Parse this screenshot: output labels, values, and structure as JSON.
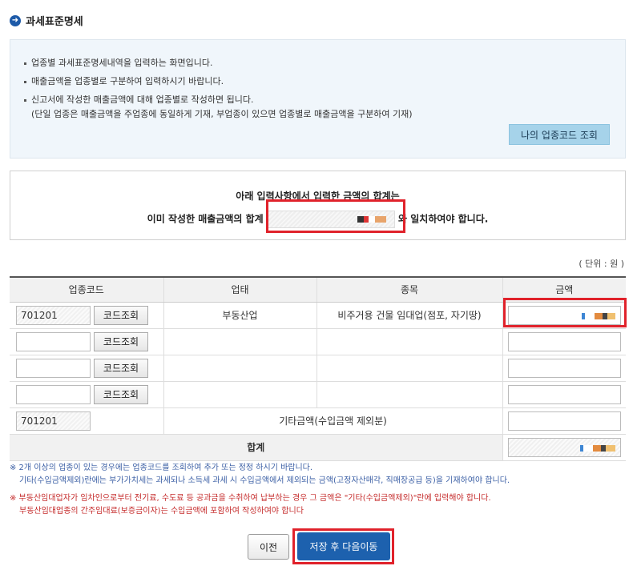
{
  "page": {
    "title": "과세표준명세"
  },
  "info": {
    "lines": [
      "업종별 과세표준명세내역을 입력하는 화면입니다.",
      "매출금액을 업종별로 구분하여 입력하시기 바랍니다.",
      "신고서에 작성한 매출금액에 대해 업종별로 작성하면 됩니다."
    ],
    "sub_line": "(단일 업종은 매출금액을 주업종에 동일하게 기재, 부업종이 있으면 업종별로 매출금액을 구분하여 기재)",
    "my_code_button": "나의 업종코드 조회"
  },
  "notice": {
    "line1": "아래 입력사항에서  입력한 금액의 합계는",
    "line2_before": "이미 작성한 매출금액의 합계",
    "line2_after": "와 일치하여야 합니다."
  },
  "unit_label": "( 단위 : 원 )",
  "table": {
    "headers": [
      "업종코드",
      "업태",
      "종목",
      "금액"
    ],
    "lookup_label": "코드조회",
    "rows": [
      {
        "code": "701201",
        "business_type": "부동산업",
        "item": "비주거용 건물 임대업(점포, 자기땅)"
      },
      {
        "code": "",
        "business_type": "",
        "item": ""
      },
      {
        "code": "",
        "business_type": "",
        "item": ""
      },
      {
        "code": "",
        "business_type": "",
        "item": ""
      }
    ],
    "other_row": {
      "code": "701201",
      "label": "기타금액(수입금액 제외분)"
    },
    "total_label": "합계"
  },
  "notes_blue": [
    "※ 2개 이상의 업종이 있는 경우에는 업종코드를 조회하여 추가 또는 정정 하시기 바랍니다.",
    "기타(수입금액제외)란에는 부가가치세는 과세되나 소득세 과세 시 수입금액에서 제외되는 금액(고정자산매각, 직매장공급 등)을 기재하여야 합니다."
  ],
  "notes_red": [
    "※ 부동산임대업자가 임차인으로부터 전기료, 수도료 등 공과금을 수취하여 납부하는 경우 그 금액은 \"기타(수입금액제외)\"란에 입력해야 합니다.",
    "부동산임대업종의 간주임대료(보증금이자)는 수입금액에 포함하여 작성하여야 합니다"
  ],
  "buttons": {
    "prev": "이전",
    "next": "저장 후 다음이동"
  }
}
